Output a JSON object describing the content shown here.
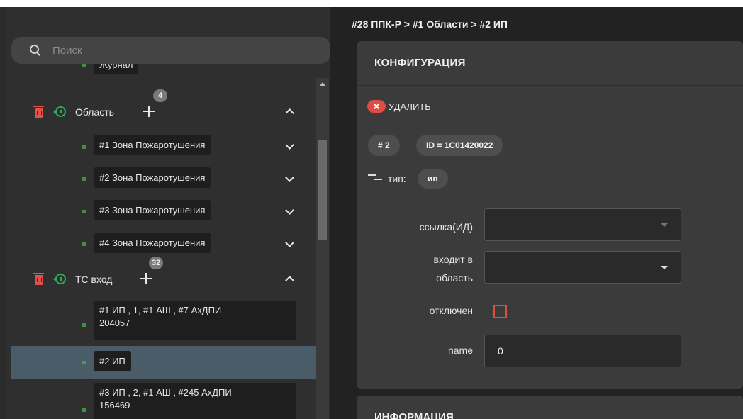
{
  "search": {
    "placeholder": "Поиск"
  },
  "tree": {
    "journal_label": "Журнал",
    "group_area": {
      "label": "Область",
      "count": "4"
    },
    "areas": [
      "#1 Зона Пожаротушения",
      "#2 Зона Пожаротушения",
      "#3 Зона Пожаротушения",
      "#4 Зона Пожаротушения"
    ],
    "group_tc": {
      "label": "ТС вход",
      "count": "32"
    },
    "tc_items": [
      {
        "line1": "#1 ИП , 1, #1 АШ , #7 АхДПИ",
        "line2": "204057"
      },
      {
        "line1": "#2 ИП",
        "line2": ""
      },
      {
        "line1": "#3 ИП , 2, #1 АШ , #245 АхДПИ",
        "line2": "156469"
      }
    ]
  },
  "breadcrumb": "#28 ППК-Р > #1 Области > #2 ИП",
  "config": {
    "title": "КОНФИГУРАЦИЯ",
    "delete_label": "УДАЛИТЬ",
    "number_pill": "# 2",
    "id_pill": "ID = 1C01420022",
    "type_label": "тип:",
    "type_value": "ип",
    "link_label": "ссылка(ИД)",
    "area_label_1": "входит в",
    "area_label_2": "область",
    "disabled_label": "отключен",
    "name_label": "name",
    "name_value": "0"
  },
  "info": {
    "title": "ИНФОРМАЦИЯ"
  },
  "colors": {
    "accent_red": "#e24b43",
    "green": "#2fae5a",
    "selected": "#4b5c69"
  }
}
